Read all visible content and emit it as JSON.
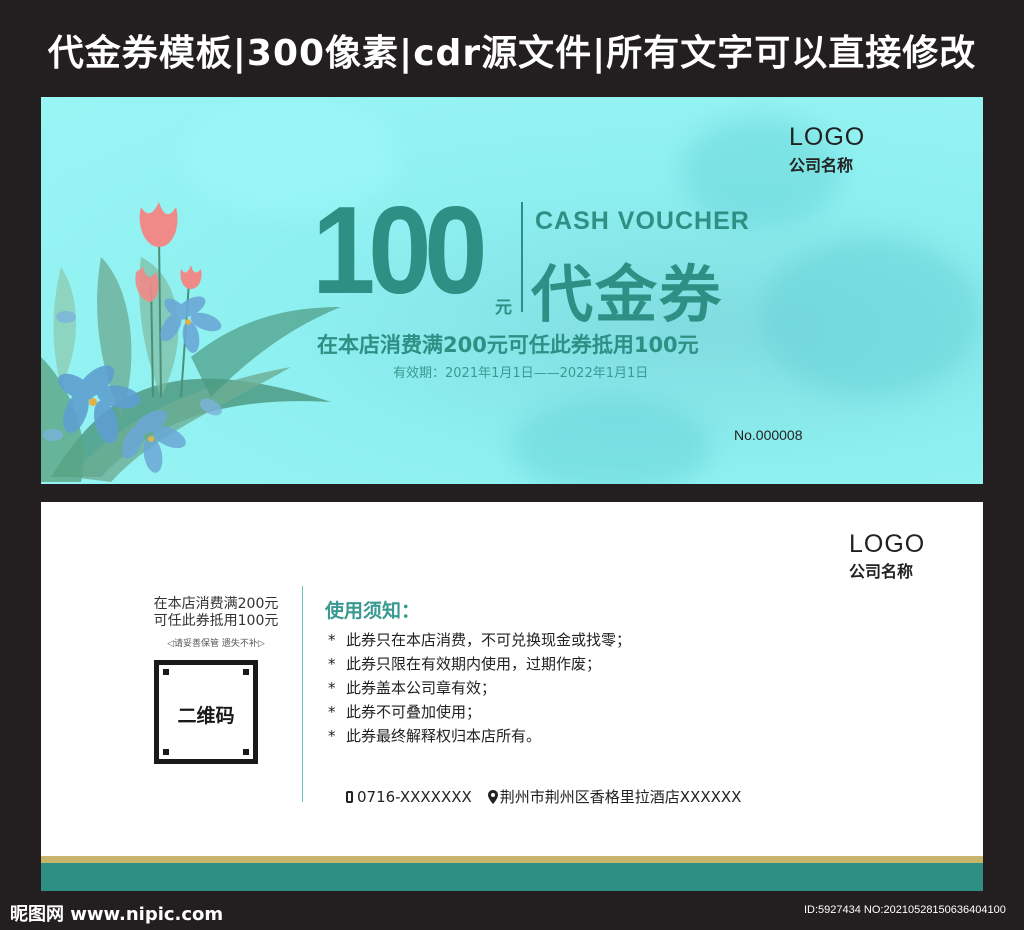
{
  "header": {
    "title": "代金券模板|300像素|cdr源文件|所有文字可以直接修改"
  },
  "front": {
    "amount": "100",
    "amount_unit": "元",
    "cash_voucher_en": "CASH VOUCHER",
    "voucher_cn": "代金券",
    "condition": "在本店消费满200元可任此券抵用100元",
    "validity": "有效期：2021年1月1日——2022年1月1日",
    "logo": "LOGO",
    "company": "公司名称",
    "serial": "No.000008",
    "colors": {
      "background": "#8ef0f0",
      "accent": "#2e8f85"
    }
  },
  "back": {
    "logo": "LOGO",
    "company": "公司名称",
    "left_condition_line1": "在本店消费满200元",
    "left_condition_line2": "可任此券抵用100元",
    "keep_note": "◁请妥善保管  遗失不补▷",
    "qr_label": "二维码",
    "notice_title": "使用须知：",
    "notice_items": [
      "此券只在本店消费，不可兑换现金或找零；",
      "此券只限在有效期内使用，过期作废；",
      "此券盖本公司章有效；",
      "此券不可叠加使用；",
      "此券最终解释权归本店所有。"
    ],
    "phone": "0716-XXXXXXX",
    "address": "荆州市荆州区香格里拉酒店XXXXXX",
    "icons": {
      "phone": "phone-icon",
      "location": "map-pin-icon"
    },
    "colors": {
      "stripe_gold": "#c6b56a",
      "stripe_teal": "#2e8f85"
    }
  },
  "footer": {
    "site": "昵图网 www.nipic.com",
    "id": "ID:5927434 NO:20210528150636404100"
  }
}
